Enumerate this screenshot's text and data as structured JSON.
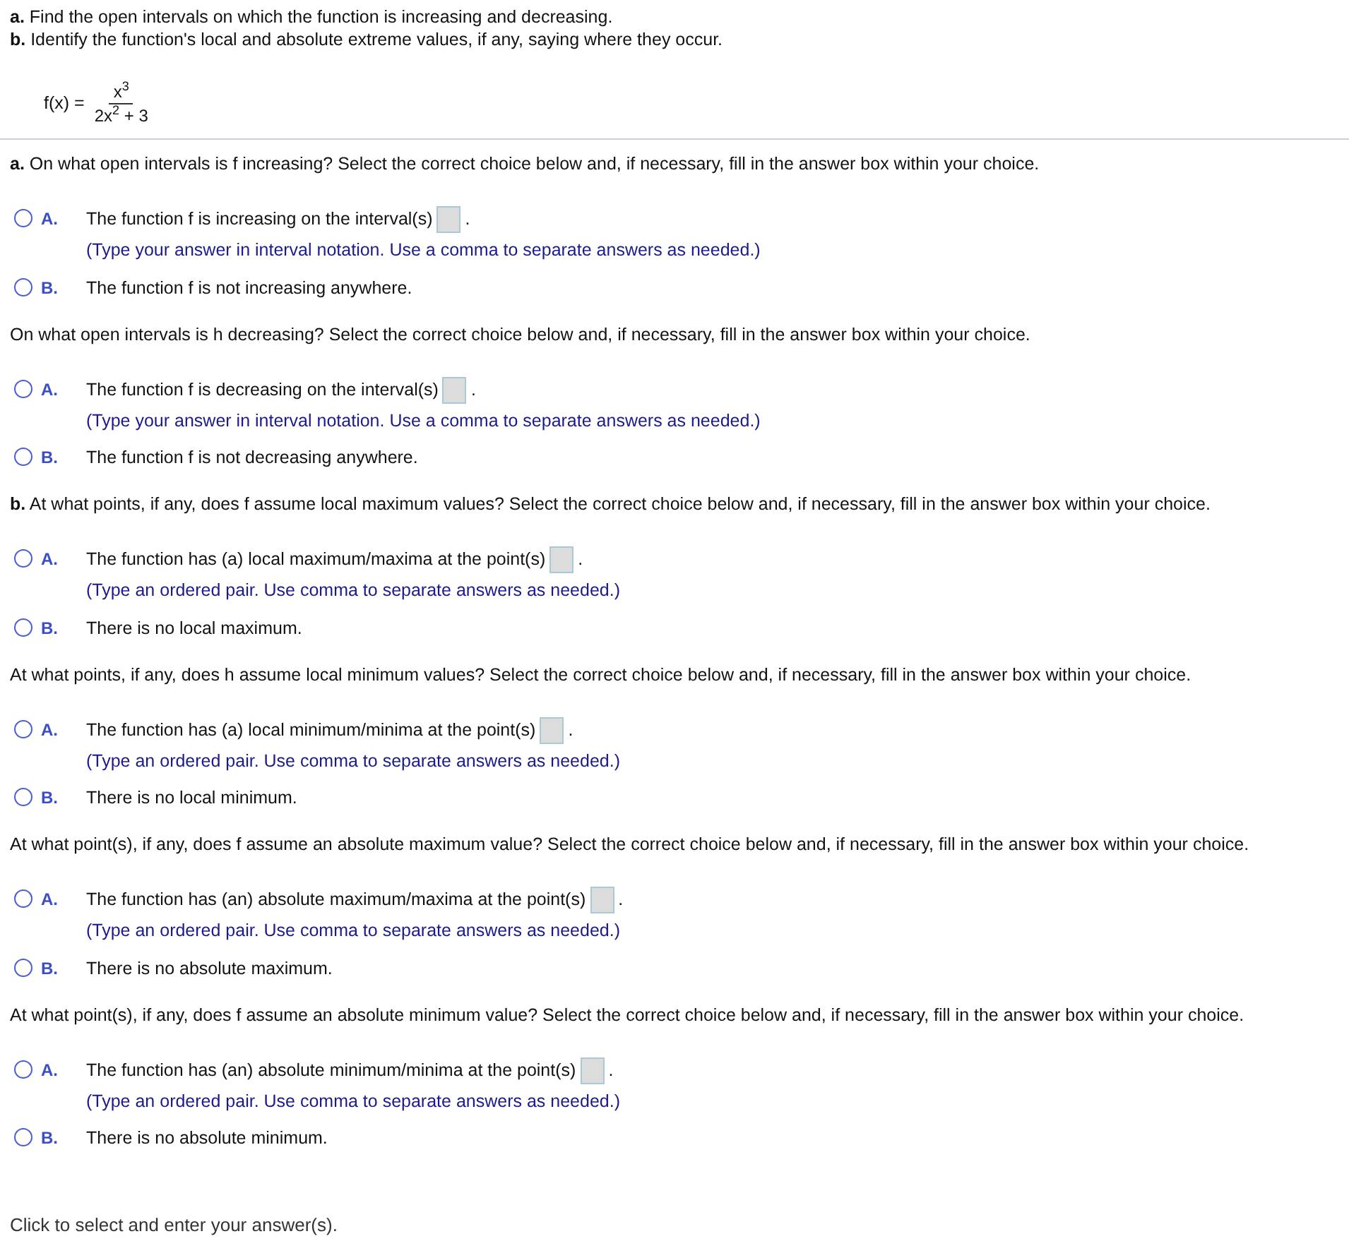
{
  "instructions": [
    "**a.** Find the open intervals on which the function is increasing and decreasing.",
    "**b.** Identify the function's local and absolute extreme values, if any, saying where they occur."
  ],
  "formula": {
    "lhs": "f(x) =",
    "numerator": "x$^{3}$",
    "denominator": "2x$^{2}$ + 3"
  },
  "questions": [
    {
      "prompt": "**a.** On what open intervals is f increasing? Select the correct choice below and, if necessary, fill in the answer box within your choice.",
      "choices": [
        {
          "kind": "answer_box",
          "letter": "A.",
          "selected": false,
          "text": "The function f is increasing on the interval(s)",
          "after": ".",
          "hint": "(Type your answer in interval notation. Use a comma to separate answers as needed.)"
        },
        {
          "kind": "statement",
          "letter": "B.",
          "selected": false,
          "text": "The function f is not increasing anywhere."
        }
      ]
    },
    {
      "prompt": "On what open intervals is h decreasing? Select the correct choice below and, if necessary, fill in the answer box within your choice.",
      "choices": [
        {
          "kind": "answer_box",
          "letter": "A.",
          "selected": false,
          "text": "The function f is decreasing on the interval(s)",
          "after": ".",
          "hint": "(Type your answer in interval notation. Use a comma to separate answers as needed.)"
        },
        {
          "kind": "statement",
          "letter": "B.",
          "selected": false,
          "text": "The function f is not decreasing anywhere."
        }
      ]
    },
    {
      "prompt": "**b.** At what points, if any, does f assume local maximum values? Select the correct choice below and, if necessary, fill in the answer box within your choice.",
      "choices": [
        {
          "kind": "answer_box",
          "letter": "A.",
          "selected": false,
          "text": "The function has (a) local maximum/maxima at the point(s)",
          "after": ".",
          "hint": "(Type an ordered pair. Use comma to separate answers as needed.)"
        },
        {
          "kind": "statement",
          "letter": "B.",
          "selected": false,
          "text": "There is no local maximum."
        }
      ]
    },
    {
      "prompt": "At what points, if any, does h assume local minimum values? Select the correct choice below and, if necessary, fill in the answer box within your choice.",
      "choices": [
        {
          "kind": "answer_box",
          "letter": "A.",
          "selected": false,
          "text": "The function has (a) local minimum/minima at the point(s)",
          "after": ".",
          "hint": "(Type an ordered pair. Use comma to separate answers as needed.)"
        },
        {
          "kind": "statement",
          "letter": "B.",
          "selected": false,
          "text": "There is no local minimum."
        }
      ]
    },
    {
      "prompt": "At what point(s), if any, does f assume an absolute maximum value? Select the correct choice below and, if necessary, fill in the answer box within your choice.",
      "choices": [
        {
          "kind": "answer_box",
          "letter": "A.",
          "selected": false,
          "text": "The function has (an) absolute maximum/maxima at the point(s)",
          "after": ".",
          "hint": "(Type an ordered pair. Use comma to separate answers as needed.)"
        },
        {
          "kind": "statement",
          "letter": "B.",
          "selected": false,
          "text": "There is no absolute maximum."
        }
      ]
    },
    {
      "prompt": "At what point(s), if any, does f assume an absolute minimum value? Select the correct choice below and, if necessary, fill in the answer box within your choice.",
      "choices": [
        {
          "kind": "answer_box",
          "letter": "A.",
          "selected": false,
          "text": "The function has (an) absolute minimum/minima at the point(s)",
          "after": ".",
          "hint": "(Type an ordered pair. Use comma to separate answers as needed.)"
        },
        {
          "kind": "statement",
          "letter": "B.",
          "selected": false,
          "text": "There is no absolute minimum."
        }
      ]
    }
  ],
  "footer": "Click to select and enter your answer(s)."
}
